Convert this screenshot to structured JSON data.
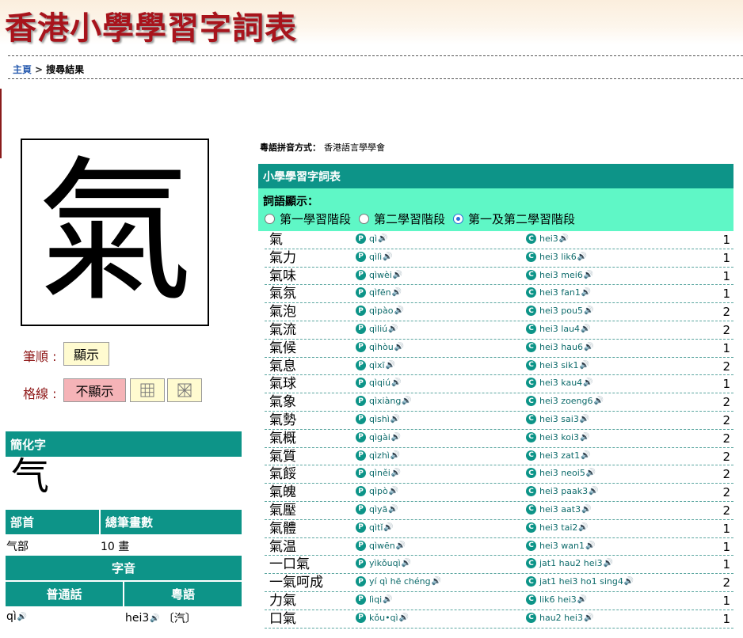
{
  "header": {
    "title": "香港小學學習字詞表"
  },
  "breadcrumb": {
    "home": "主頁",
    "sep": ">",
    "current": "搜尋結果"
  },
  "character": {
    "main": "氣"
  },
  "controls": {
    "stroke_label": "筆順 :",
    "stroke_button": "顯示",
    "grid_label": "格線 :",
    "grid_hide": "不顯示",
    "grid_icon_1": "grid-square-icon",
    "grid_icon_2": "grid-diagonal-icon"
  },
  "simplified": {
    "header": "簡化字",
    "char": "气"
  },
  "info": {
    "radical_header": "部首",
    "strokes_header": "總筆畫數",
    "radical": "气部",
    "strokes": "10 畫",
    "pron_header": "字音",
    "mandarin_header": "普通話",
    "cantonese_header": "粵語",
    "mandarin": "qì",
    "cantonese": "hei3",
    "cantonese_note": "〔汽〕"
  },
  "method": {
    "label": "粵語拼音方式：",
    "value": "香港語言學學會"
  },
  "table": {
    "title": "小學學習字詞表",
    "display_label": "詞語顯示：",
    "options": [
      "第一學習階段",
      "第二學習階段",
      "第一及第二學習階段"
    ],
    "selected": 2,
    "badge_p": "P",
    "badge_c": "C",
    "speaker_icon": "speaker-icon",
    "rows": [
      {
        "word": "氣",
        "pinyin": "qì",
        "jyutping": "hei3",
        "level": "1"
      },
      {
        "word": "氣力",
        "pinyin": "qìlì",
        "jyutping": "hei3 lik6",
        "level": "1"
      },
      {
        "word": "氣味",
        "pinyin": "qìwèi",
        "jyutping": "hei3 mei6",
        "level": "1"
      },
      {
        "word": "氣氛",
        "pinyin": "qìfēn",
        "jyutping": "hei3 fan1",
        "level": "1"
      },
      {
        "word": "氣泡",
        "pinyin": "qìpào",
        "jyutping": "hei3 pou5",
        "level": "2"
      },
      {
        "word": "氣流",
        "pinyin": "qìliú",
        "jyutping": "hei3 lau4",
        "level": "2"
      },
      {
        "word": "氣候",
        "pinyin": "qìhòu",
        "jyutping": "hei3 hau6",
        "level": "1"
      },
      {
        "word": "氣息",
        "pinyin": "qìxī",
        "jyutping": "hei3 sik1",
        "level": "2"
      },
      {
        "word": "氣球",
        "pinyin": "qìqiú",
        "jyutping": "hei3 kau4",
        "level": "1"
      },
      {
        "word": "氣象",
        "pinyin": "qìxiàng",
        "jyutping": "hei3 zoeng6",
        "level": "2"
      },
      {
        "word": "氣勢",
        "pinyin": "qìshì",
        "jyutping": "hei3 sai3",
        "level": "2"
      },
      {
        "word": "氣概",
        "pinyin": "qìgài",
        "jyutping": "hei3 koi3",
        "level": "2"
      },
      {
        "word": "氣質",
        "pinyin": "qìzhì",
        "jyutping": "hei3 zat1",
        "level": "2"
      },
      {
        "word": "氣餒",
        "pinyin": "qìněi",
        "jyutping": "hei3 neoi5",
        "level": "2"
      },
      {
        "word": "氣魄",
        "pinyin": "qìpò",
        "jyutping": "hei3 paak3",
        "level": "2"
      },
      {
        "word": "氣壓",
        "pinyin": "qìyā",
        "jyutping": "hei3 aat3",
        "level": "2"
      },
      {
        "word": "氣體",
        "pinyin": "qìtǐ",
        "jyutping": "hei3 tai2",
        "level": "1"
      },
      {
        "word": "氣温",
        "pinyin": "qìwēn",
        "jyutping": "hei3 wan1",
        "level": "1"
      },
      {
        "word": "一口氣",
        "pinyin": "yìkǒuqì",
        "jyutping": "jat1 hau2 hei3",
        "level": "1"
      },
      {
        "word": "一氣呵成",
        "pinyin": "yí qì hē chéng",
        "jyutping": "jat1 hei3 ho1 sing4",
        "level": "2"
      },
      {
        "word": "力氣",
        "pinyin": "lìqi",
        "jyutping": "lik6 hei3",
        "level": "1"
      },
      {
        "word": "口氣",
        "pinyin": "kǒu•qì",
        "jyutping": "hau2 hei3",
        "level": "1"
      }
    ]
  }
}
